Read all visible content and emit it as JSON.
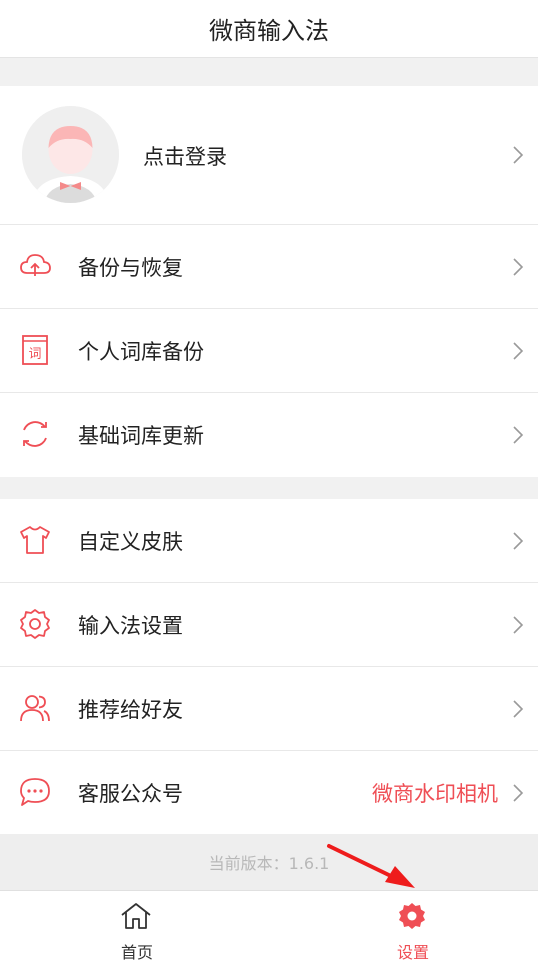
{
  "header": {
    "title": "微商输入法"
  },
  "login": {
    "label": "点击登录"
  },
  "menu": [
    {
      "label": "备份与恢复",
      "icon": "cloud-sync-icon"
    },
    {
      "label": "个人词库备份",
      "icon": "dictionary-icon"
    },
    {
      "label": "基础词库更新",
      "icon": "refresh-icon"
    },
    {
      "label": "自定义皮肤",
      "icon": "tshirt-icon"
    },
    {
      "label": "输入法设置",
      "icon": "gear-outline-icon"
    },
    {
      "label": "推荐给好友",
      "icon": "users-icon"
    },
    {
      "label": "客服公众号",
      "icon": "chat-bubble-icon",
      "value": "微商水印相机"
    }
  ],
  "dictionary_icon_text": "词",
  "version": "当前版本：1.6.1",
  "tabs": [
    {
      "label": "首页",
      "icon": "home-icon",
      "active": false
    },
    {
      "label": "设置",
      "icon": "settings-gear-icon",
      "active": true
    }
  ],
  "colors": {
    "accent": "#ef4e55",
    "background": "#f1f1f1",
    "text": "#222222"
  }
}
